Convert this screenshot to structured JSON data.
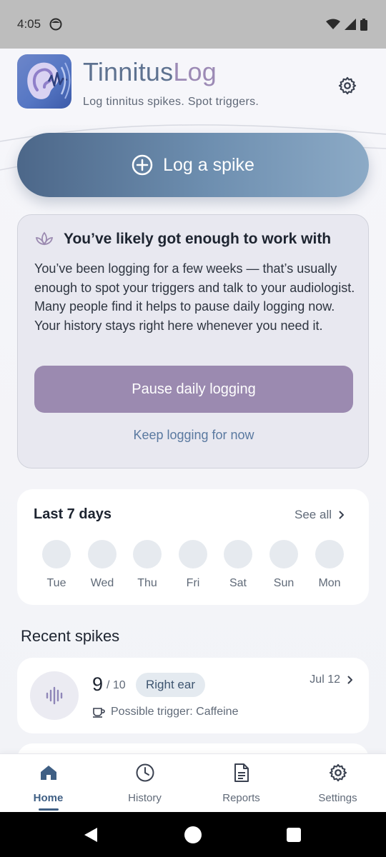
{
  "status_bar": {
    "time": "4:05"
  },
  "header": {
    "title_part1": "Tinnitus",
    "title_part2": "Log",
    "subtitle": "Log tinnitus spikes. Spot triggers."
  },
  "log_button": {
    "label": "Log a spike"
  },
  "nudge": {
    "title": "You’ve likely got enough to work with",
    "body": "You’ve been logging for a few weeks — that’s usually enough to spot your triggers and talk to your audiologist. Many people find it helps to pause daily logging now. Your history stays right here whenever you need it.",
    "pause_label": "Pause daily logging",
    "keep_label": "Keep logging for now"
  },
  "week": {
    "title": "Last 7 days",
    "see_all": "See all",
    "days": [
      "Tue",
      "Wed",
      "Thu",
      "Fri",
      "Sat",
      "Sun",
      "Mon"
    ]
  },
  "recent": {
    "title": "Recent spikes",
    "items": [
      {
        "score": "9",
        "scale": "/ 10",
        "ear": "Right ear",
        "date": "Jul 12",
        "trigger": "Possible trigger: Caffeine"
      }
    ]
  },
  "nav": {
    "items": [
      {
        "label": "Home",
        "icon": "home-icon",
        "active": true
      },
      {
        "label": "History",
        "icon": "clock-icon",
        "active": false
      },
      {
        "label": "Reports",
        "icon": "document-icon",
        "active": false
      },
      {
        "label": "Settings",
        "icon": "gear-icon",
        "active": false
      }
    ]
  },
  "colors": {
    "primary": "#4c6789",
    "accent_purple": "#9b8ab0",
    "link": "#5a79a0",
    "active_nav": "#3f5f84"
  }
}
